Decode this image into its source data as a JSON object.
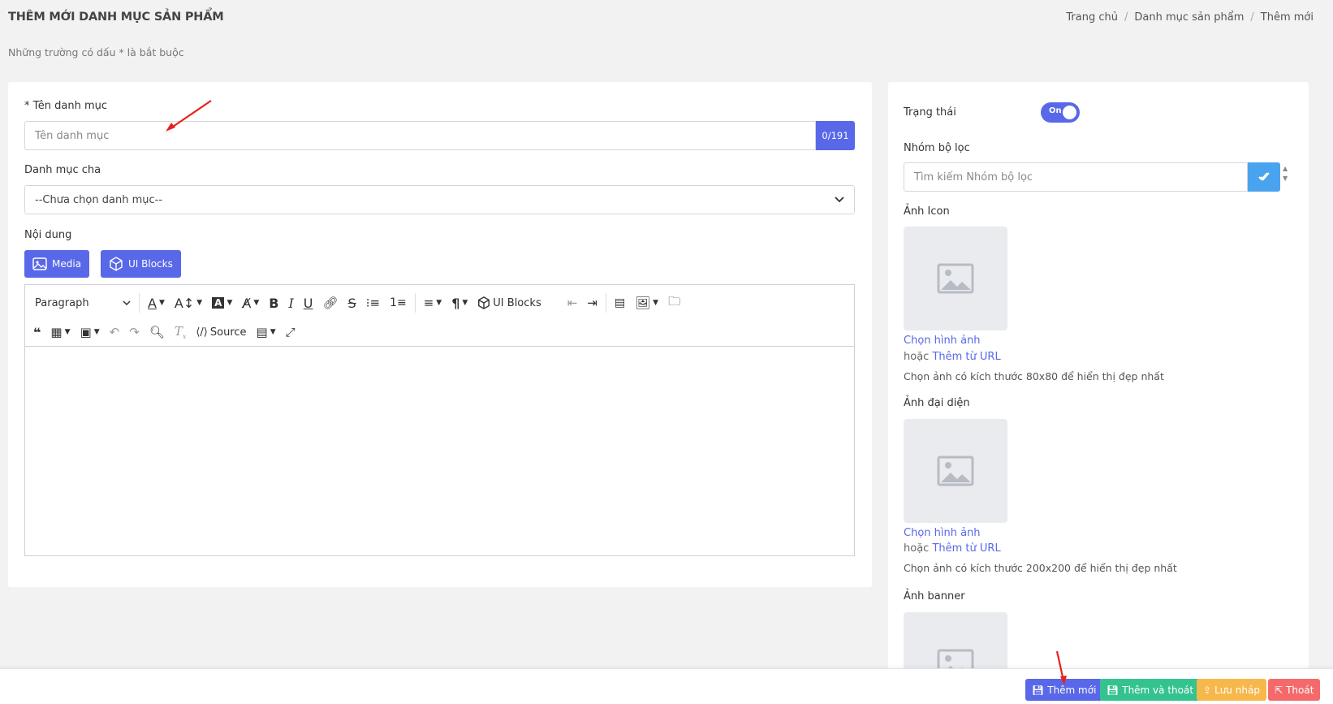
{
  "header": {
    "title": "THÊM MỚI DANH MỤC SẢN PHẨM",
    "breadcrumb": [
      "Trang chủ",
      "Danh mục sản phẩm",
      "Thêm mới"
    ],
    "required_note": "Những trường có dấu * là bắt buộc"
  },
  "form": {
    "name_label": "* Tên danh mục",
    "name_placeholder": "Tên danh mục",
    "name_counter": "0/191",
    "parent_label": "Danh mục cha",
    "parent_value": "--Chưa chọn danh mục--",
    "content_label": "Nội dung",
    "media_button": "Media",
    "ui_blocks_button": "UI Blocks"
  },
  "editor": {
    "paragraph_select": "Paragraph",
    "ui_blocks_label": "UI Blocks",
    "source_label": "Source"
  },
  "sidebar": {
    "status_label": "Trạng thái",
    "status_toggle": "On",
    "filter_group_label": "Nhóm bộ lọc",
    "filter_group_placeholder": "Tìm kiếm Nhóm bộ lọc",
    "icon_label": "Ảnh Icon",
    "icon_choose": "Chọn hình ảnh",
    "icon_or": "hoặc",
    "icon_url": "Thêm từ URL",
    "icon_hint": "Chọn ảnh có kích thước 80x80 để hiển thị đẹp nhất",
    "avatar_label": "Ảnh đại diện",
    "avatar_choose": "Chọn hình ảnh",
    "avatar_or": "hoặc",
    "avatar_url": "Thêm từ URL",
    "avatar_hint": "Chọn ảnh có kích thước 200x200 để hiển thị đẹp nhất",
    "banner_label": "Ảnh banner"
  },
  "footer": {
    "add_button": "Thêm mới",
    "add_exit_button": "Thêm và thoát",
    "draft_button": "Lưu nháp",
    "exit_button": "Thoát"
  },
  "colors": {
    "primary": "#5868e8",
    "success": "#34c38f",
    "warning": "#f7b84b",
    "danger": "#f46a6a",
    "info": "#4aa3ee"
  }
}
